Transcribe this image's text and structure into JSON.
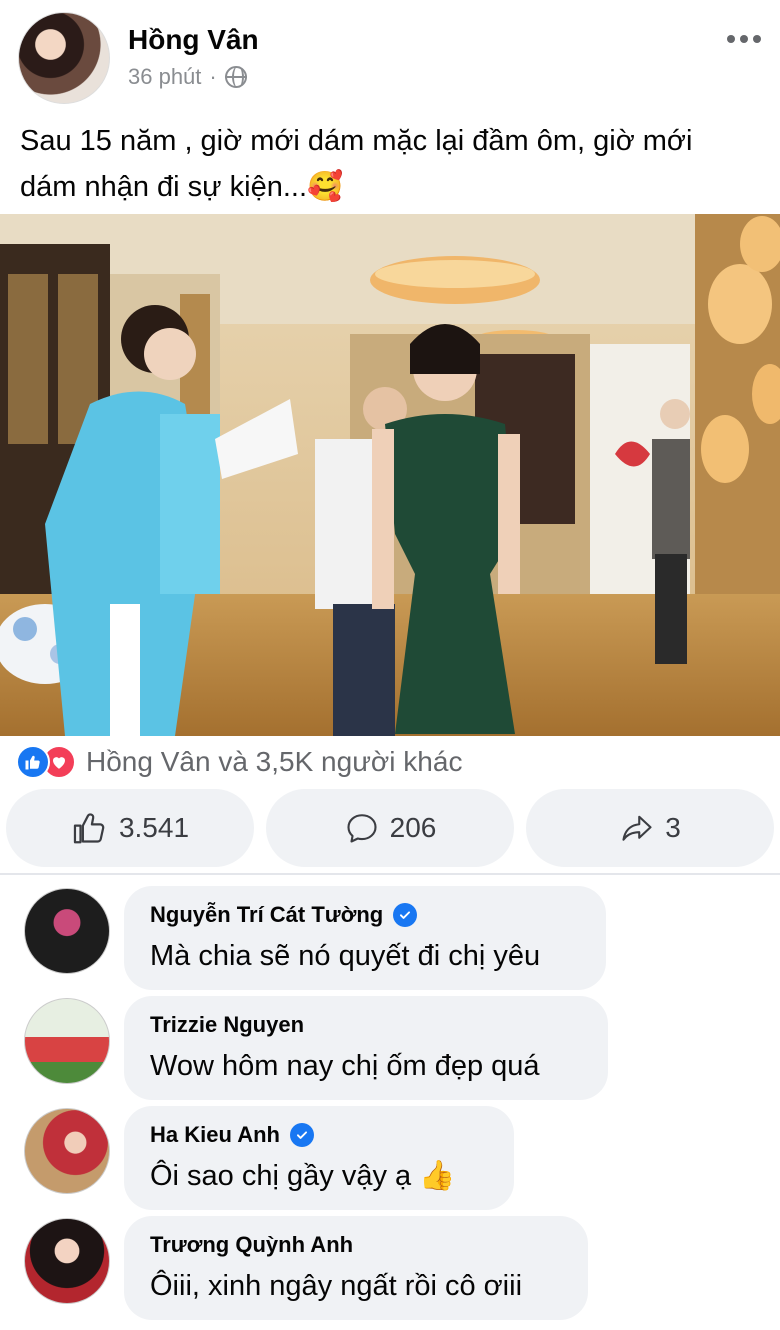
{
  "post": {
    "author": "Hồng Vân",
    "time": "36 phút",
    "separator": "·",
    "audience_icon": "globe-icon",
    "caption_line1": "Sau 15 năm , giờ mới dám mặc lại đầm ôm, giờ mới",
    "caption_line2": "dám nhận đi sự kiện...",
    "caption_emoji": "🥰"
  },
  "reactions": {
    "icons": [
      "like-icon",
      "love-icon"
    ],
    "summary": "Hồng Vân và 3,5K người khác"
  },
  "actions": {
    "like_count": "3.541",
    "comment_count": "206",
    "share_count": "3"
  },
  "comments": [
    {
      "name": "Nguyễn Trí Cát Tường",
      "verified": true,
      "text": "Mà chia sẽ nó quyết đi chị yêu"
    },
    {
      "name": "Trizzie Nguyen",
      "verified": false,
      "text": "Wow hôm nay chị ốm đẹp quá"
    },
    {
      "name": "Ha Kieu Anh",
      "verified": true,
      "text": "Ôi sao chị gầy vậy ạ",
      "emoji": "👍"
    },
    {
      "name": "Trương Quỳnh Anh",
      "verified": false,
      "text": "Ôiii, xinh ngây ngất rồi cô ơiii"
    }
  ],
  "colors": {
    "like_blue": "#1877f2",
    "love_red": "#f33e58",
    "bubble_bg": "#f0f2f5",
    "muted_text": "#65676b"
  }
}
